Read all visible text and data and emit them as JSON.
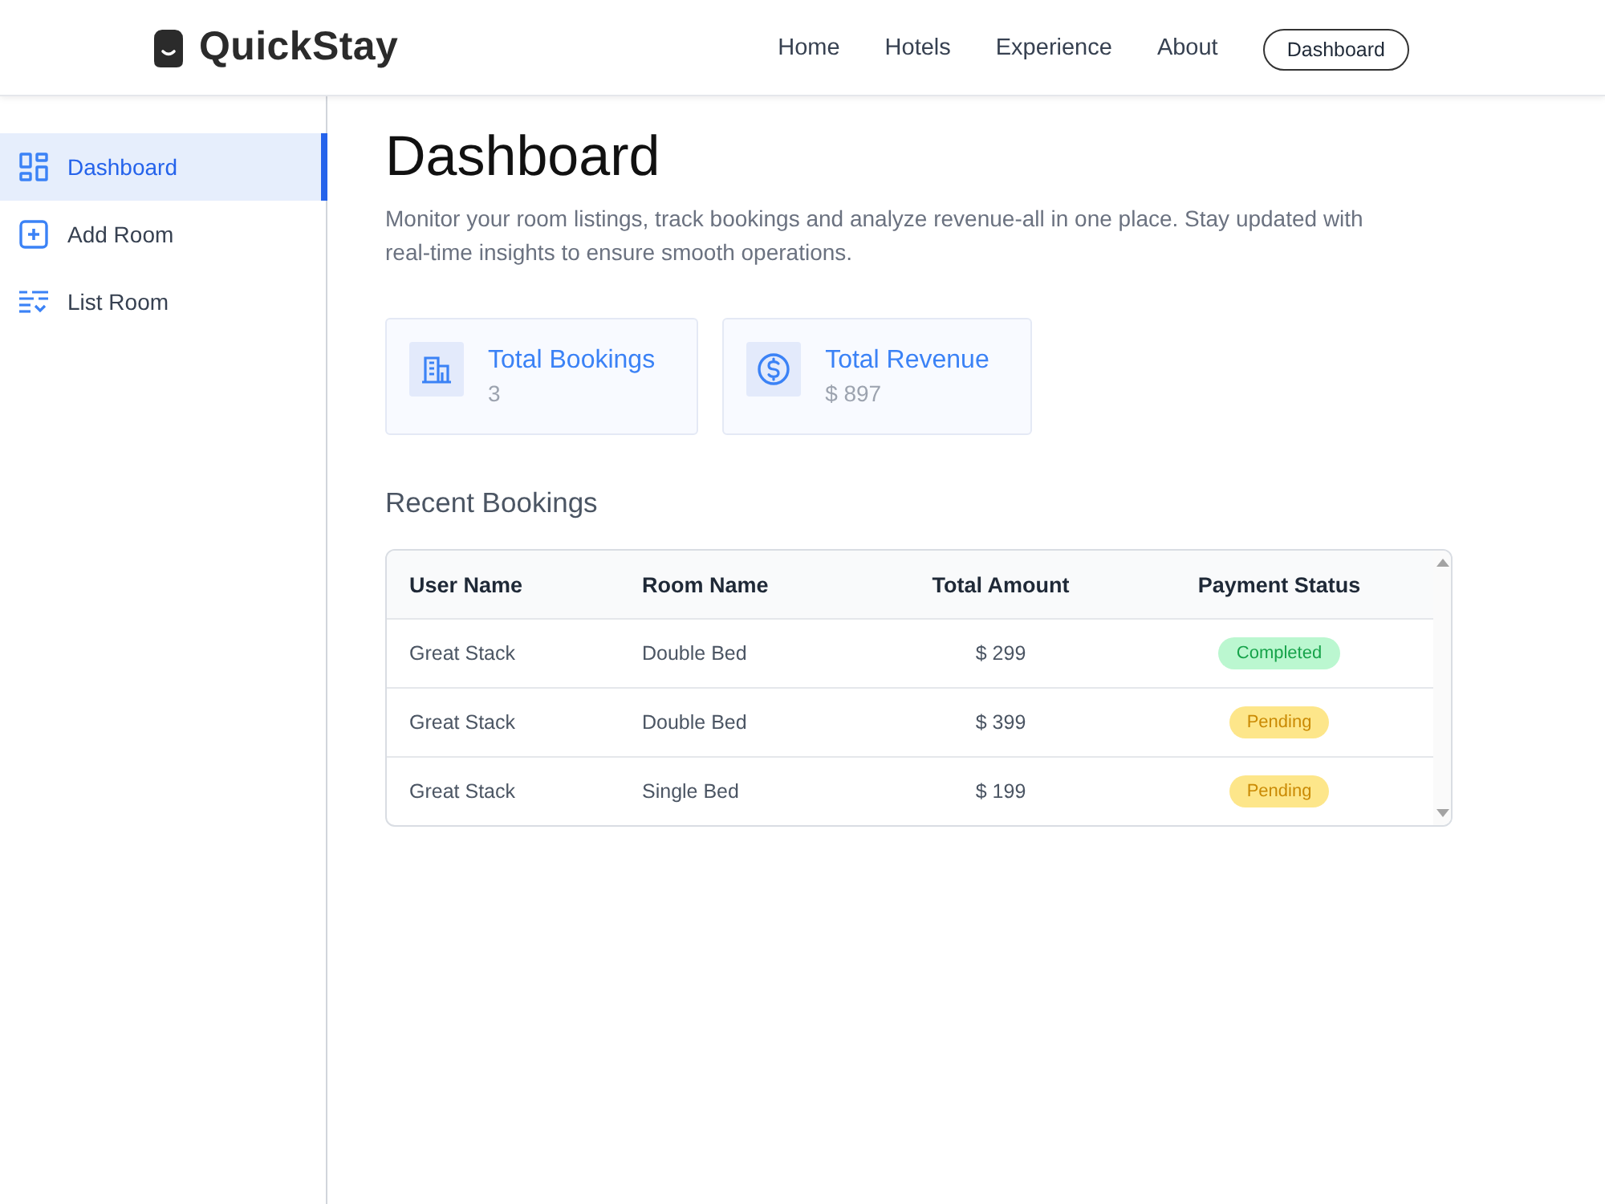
{
  "header": {
    "logo": "QuickStay",
    "nav": [
      {
        "label": "Home"
      },
      {
        "label": "Hotels"
      },
      {
        "label": "Experience"
      },
      {
        "label": "About"
      }
    ],
    "button": "Dashboard"
  },
  "sidebar": {
    "items": [
      {
        "label": "Dashboard",
        "kind": "grid",
        "selected": true
      },
      {
        "label": "Add Room",
        "kind": "add",
        "selected": false
      },
      {
        "label": "List Room",
        "kind": "list",
        "selected": false
      }
    ]
  },
  "main": {
    "title": "Dashboard",
    "description": "Monitor your room listings, track bookings and analyze revenue-all in one place. Stay updated with real-time insights to ensure smooth operations.",
    "cards": [
      {
        "kind": "bookings",
        "title": "Total Bookings",
        "value": "3"
      },
      {
        "kind": "revenue",
        "title": "Total Revenue",
        "value": "$ 897"
      }
    ],
    "recent_bookings": {
      "title": "Recent Bookings",
      "columns": [
        "User Name",
        "Room Name",
        "Total Amount",
        "Payment Status"
      ],
      "rows": [
        {
          "user_name": "Great Stack",
          "room_name": "Double Bed",
          "total_amount": "$ 299",
          "payment_status": {
            "label": "Completed",
            "kind": "completed"
          }
        },
        {
          "user_name": "Great Stack",
          "room_name": "Double Bed",
          "total_amount": "$ 399",
          "payment_status": {
            "label": "Pending",
            "kind": "pending"
          }
        },
        {
          "user_name": "Great Stack",
          "room_name": "Single Bed",
          "total_amount": "$ 199",
          "payment_status": {
            "label": "Pending",
            "kind": "pending"
          }
        }
      ]
    }
  }
}
